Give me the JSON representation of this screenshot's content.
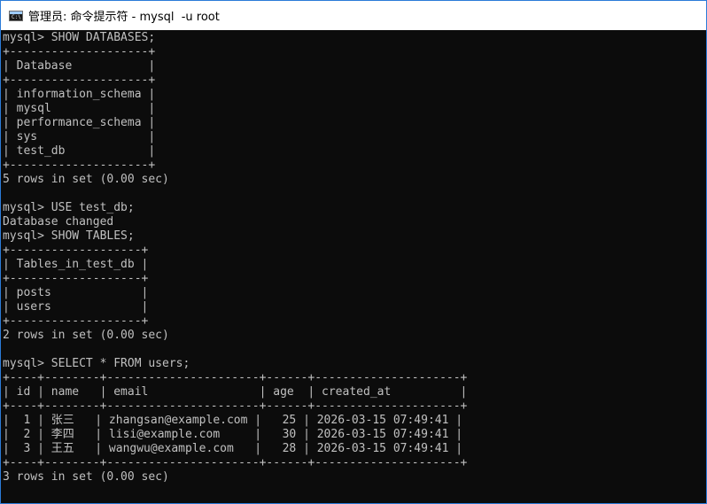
{
  "window": {
    "title": "管理员: 命令提示符 - mysql  -u root",
    "icon": "cmd-prompt-icon",
    "icon_glyph": "C:\\"
  },
  "colors": {
    "background": "#0c0c0c",
    "text": "#c0c0c0",
    "titlebar": "#ffffff",
    "border": "#2b7bd8"
  },
  "console": {
    "lines": [
      "mysql> SHOW DATABASES;",
      "+--------------------+",
      "| Database           |",
      "+--------------------+",
      "| information_schema |",
      "| mysql              |",
      "| performance_schema |",
      "| sys                |",
      "| test_db            |",
      "+--------------------+",
      "5 rows in set (0.00 sec)",
      "",
      "mysql> USE test_db;",
      "Database changed",
      "mysql> SHOW TABLES;",
      "+-------------------+",
      "| Tables_in_test_db |",
      "+-------------------+",
      "| posts             |",
      "| users             |",
      "+-------------------+",
      "2 rows in set (0.00 sec)",
      "",
      "mysql> SELECT * FROM users;",
      "+----+--------+----------------------+------+---------------------+",
      "| id | name   | email                | age  | created_at          |",
      "+----+--------+----------------------+------+---------------------+",
      "|  1 | 张三   | zhangsan@example.com |   25 | 2026-03-15 07:49:41 |",
      "|  2 | 李四   | lisi@example.com     |   30 | 2026-03-15 07:49:41 |",
      "|  3 | 王五   | wangwu@example.com   |   28 | 2026-03-15 07:49:41 |",
      "+----+--------+----------------------+------+---------------------+",
      "3 rows in set (0.00 sec)"
    ]
  }
}
